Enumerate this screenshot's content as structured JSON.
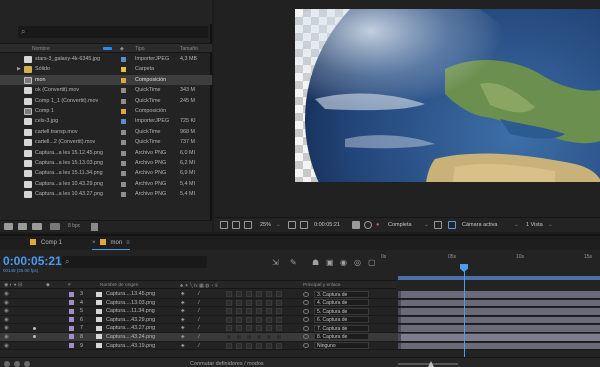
{
  "project": {
    "search_placeholder": "",
    "columns": {
      "name": "Nombre",
      "type": "Tipo",
      "size": "Tamaño"
    },
    "items": [
      {
        "name": "stars-3_galaxy-4k-6345.jpg",
        "type": "ImporterJPEG",
        "size": "4,3 MB",
        "kind": "file",
        "label_color": "#5a8ec8"
      },
      {
        "name": "Sólido",
        "type": "Carpeta",
        "size": "",
        "kind": "folder",
        "label_color": "#e3c143"
      },
      {
        "name": "mon",
        "type": "Composición",
        "size": "",
        "kind": "comp",
        "label_color": "#e0a73c",
        "selected": true
      },
      {
        "name": "ok (Convertit).mov",
        "type": "QuickTime",
        "size": "343 M",
        "kind": "file",
        "label_color": "#8e8e8e"
      },
      {
        "name": "Comp 1_1 (Convertit).mov",
        "type": "QuickTime",
        "size": "245 M",
        "kind": "file",
        "label_color": "#8e8e8e"
      },
      {
        "name": "Comp 1",
        "type": "Composición",
        "size": "",
        "kind": "comp",
        "label_color": "#e0a73c"
      },
      {
        "name": "cels-3.jpg",
        "type": "ImporterJPEG",
        "size": "725 KI",
        "kind": "file",
        "label_color": "#5a8ec8"
      },
      {
        "name": "cartell transp.mov",
        "type": "QuickTime",
        "size": "968 M",
        "kind": "file",
        "label_color": "#8e8e8e"
      },
      {
        "name": "cartell...2 (Convertit).mov",
        "type": "QuickTime",
        "size": "737 M",
        "kind": "file",
        "label_color": "#8e8e8e"
      },
      {
        "name": "Captura...a les 15.12.45.png",
        "type": "Archivo PNG",
        "size": "6,0 MI",
        "kind": "file",
        "label_color": "#8e8e8e"
      },
      {
        "name": "Captura...a les 15.13.03.png",
        "type": "Archivo PNG",
        "size": "6,2 MI",
        "kind": "file",
        "label_color": "#8e8e8e"
      },
      {
        "name": "Captura...a les 15.11.34.png",
        "type": "Archivo PNG",
        "size": "6,9 MI",
        "kind": "file",
        "label_color": "#8e8e8e"
      },
      {
        "name": "Captura...a les 10.43.29.png",
        "type": "Archivo PNG",
        "size": "5,4 MI",
        "kind": "file",
        "label_color": "#8e8e8e"
      },
      {
        "name": "Captura...a les 10.43.27.png",
        "type": "Archivo PNG",
        "size": "5,4 MI",
        "kind": "file",
        "label_color": "#8e8e8e"
      }
    ],
    "footer": {
      "bpc": "8 bpc"
    }
  },
  "viewer": {
    "zoom": "25%",
    "timecode": "0:00:05:21",
    "resolution": "Completa",
    "camera": "Cámara activa",
    "views": "1 Vista"
  },
  "timeline": {
    "tabs": [
      {
        "label": "Comp 1",
        "active": false
      },
      {
        "label": "mon",
        "active": true
      }
    ],
    "timecode": "0:00:05:21",
    "timecode_sub": "00146 (25.00 fps)",
    "ruler_ticks": [
      "0s",
      "05s",
      "10s",
      "15s"
    ],
    "columns": {
      "source_name": "Nombre de origen",
      "parent": "Principal y enlace"
    },
    "layers": [
      {
        "num": "3",
        "name": "Captura....13.45.png",
        "parent": "3. Captura de",
        "label_color": "#a08ec8",
        "dot": false,
        "selected": false
      },
      {
        "num": "4",
        "name": "Captura....13.03.png",
        "parent": "4. Captura de",
        "label_color": "#a08ec8",
        "dot": false,
        "selected": false
      },
      {
        "num": "5",
        "name": "Captura....11.34.png",
        "parent": "5. Captura de",
        "label_color": "#a08ec8",
        "dot": false,
        "selected": false
      },
      {
        "num": "6",
        "name": "Captura....43.29.png",
        "parent": "6. Captura de",
        "label_color": "#a08ec8",
        "dot": false,
        "selected": false
      },
      {
        "num": "7",
        "name": "Captura....43.27.png",
        "parent": "7. Captura de",
        "label_color": "#a08ec8",
        "dot": true,
        "selected": false
      },
      {
        "num": "8",
        "name": "Captura....43.24.png",
        "parent": "8. Captura de",
        "label_color": "#a08ec8",
        "dot": true,
        "selected": true
      },
      {
        "num": "9",
        "name": "Captura....43.19.png",
        "parent": "Ninguno",
        "label_color": "#a08ec8",
        "dot": false,
        "selected": false
      }
    ],
    "footer_label": "Conmutar definidores / modos"
  }
}
